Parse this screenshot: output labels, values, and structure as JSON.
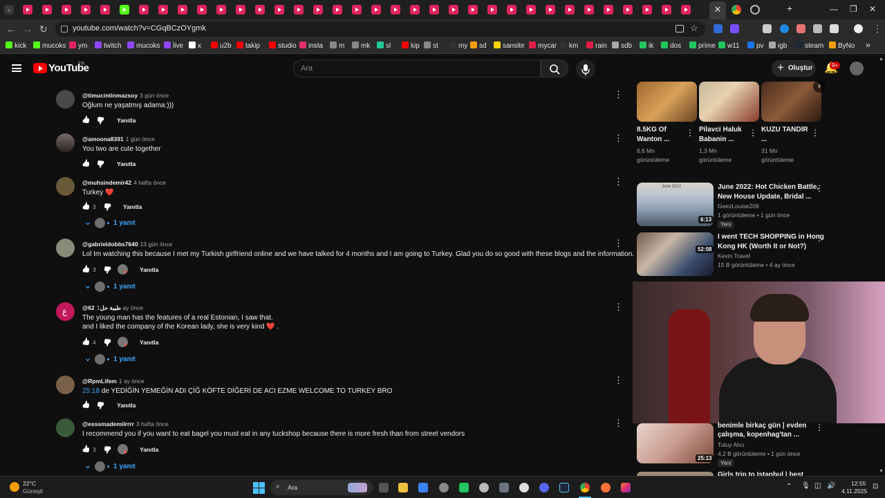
{
  "browser": {
    "url": "youtube.com/watch?v=CGqBCzOYgmk",
    "bookmarks": [
      "kick",
      "mucoks",
      "ym",
      "twitch",
      "mucoks",
      "live",
      "x",
      "u2b",
      "takip",
      "studio",
      "insta",
      "m",
      "mk",
      "sl",
      "kip",
      "st",
      "my",
      "sd",
      "sansite",
      "mycar",
      "km",
      "rain",
      "sdb",
      "ik",
      "dos",
      "prime",
      "w11",
      "pv",
      "igb",
      "steam",
      "ByNo"
    ]
  },
  "header": {
    "logo_text": "YouTube",
    "country": "TR",
    "search_placeholder": "Ara",
    "create_label": "Oluştur",
    "notif_count": "9+"
  },
  "comments": [
    {
      "user": "@timucintinmazsoy",
      "time": "3 gün önce",
      "lines": [
        "Oğlum ne yaşatmış adama:)))"
      ],
      "likes": "",
      "reply_label": "Yanıtla"
    },
    {
      "user": "@amoona8391",
      "time": "1 gün önce",
      "lines": [
        "You two are cute together"
      ],
      "likes": "",
      "reply_label": "Yanıtla"
    },
    {
      "user": "@muhsindemir42",
      "time": "4 hafta önce",
      "lines": [
        "Turkey ❤️"
      ],
      "likes": "3",
      "reply_label": "Yanıtla",
      "replies": "1 yanıt"
    },
    {
      "user": "@gabrieldobbs7640",
      "time": "13 gün önce",
      "lines": [
        "Lol Im watching this because I met my Turkish girlfriend online and we have talked for 4 months and I am going to Turkey. Glad you do so good with these blogs and the information."
      ],
      "likes": "3",
      "reply_label": "Yanıtla",
      "replies": "1 yanıt"
    },
    {
      "user": "@62طيبة حل",
      "time": "1 ay önce",
      "lines": [
        "The young man has the features of a real Estonian, I saw that.",
        " and I liked the company of the Korean lady, she is very kind ❤️ ."
      ],
      "likes": "4",
      "reply_label": "Yanıtla",
      "replies": "1 yanıt",
      "avatar_letter": "ع"
    },
    {
      "user": "@RpmLifem",
      "time": "1 ay önce",
      "timestamp": "25:18",
      "lines": [
        " de YEDİĞİN YEMEĞİN ADI ÇİĞ KÖFTE DİĞERİ DE ACI EZME   WELCOME TO TURKEY BRO"
      ],
      "likes": "",
      "reply_label": "Yanıtla"
    },
    {
      "user": "@esssmademiirrrr",
      "time": "3 hafta önce",
      "lines": [
        "I recommend you if you want to eat bagel you must eat in any tuckshop because there is more fresh than from street vendors"
      ],
      "likes": "3",
      "reply_label": "Yanıtla",
      "replies": "1 yanıt"
    }
  ],
  "shorts": [
    {
      "title": "8.5KG Of Wanton ...",
      "views": "6,6 Mn görüntüleme"
    },
    {
      "title": "Pilavci Haluk Babanin ...",
      "views": "1,3 Mn görüntüleme"
    },
    {
      "title": "KUZU TANDIR ...",
      "views": "31 Mn görüntüleme"
    }
  ],
  "related": [
    {
      "title_1": "June 2022: Hot Chicken Battle,",
      "title_2": "New House Update, Bridal ...",
      "channel": "GeezLouise209",
      "meta": "1 görüntüleme • 1 gün önce",
      "duration": "6:13",
      "badge": "Yeni",
      "thumb_caption": "June 2022"
    },
    {
      "title_1": "I went TECH SHOPPING in Hong",
      "title_2": "Kong HK (Worth It or Not?)",
      "channel": "Kevin Travel",
      "meta": "15 B görüntüleme • 4 ay önce",
      "duration": "52:08"
    },
    {
      "title_1": "benimle birkaç gün | evden",
      "title_2": "çalışma, kopenhag'tan ...",
      "channel": "Tuluy Alıcı",
      "meta": "4,2 B görüntüleme • 1 gün önce",
      "duration": "25:13",
      "badge": "Yeni"
    },
    {
      "title_1": "Girls trip to Istanbul | best"
    }
  ],
  "taskbar": {
    "temp": "22°C",
    "weather": "Güneşli",
    "search": "Ara",
    "time": "12:55",
    "date": "4.11.2025"
  }
}
